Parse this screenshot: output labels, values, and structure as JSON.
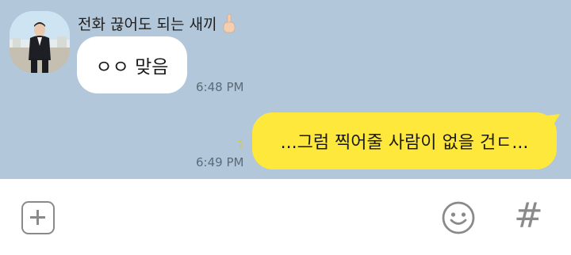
{
  "chat": {
    "incoming": {
      "sender_name": "전화 끊어도 되는 새끼",
      "message": "ㅇㅇ 맞음",
      "time": "6:48 PM"
    },
    "outgoing": {
      "message": "...그럼 찍어줄 사람이 없을 건ㄷ...",
      "unread_count": "1",
      "time": "6:49 PM"
    }
  },
  "input_bar": {
    "attach_icon": "plus-square-icon",
    "emoji_icon": "smiley-icon",
    "hash_icon": "hash-icon",
    "hash_glyph": "#"
  },
  "colors": {
    "chat_background": "#b2c7d9",
    "outgoing_bubble": "#fee83b",
    "incoming_bubble": "#ffffff",
    "unread_count": "#e7c81b"
  }
}
